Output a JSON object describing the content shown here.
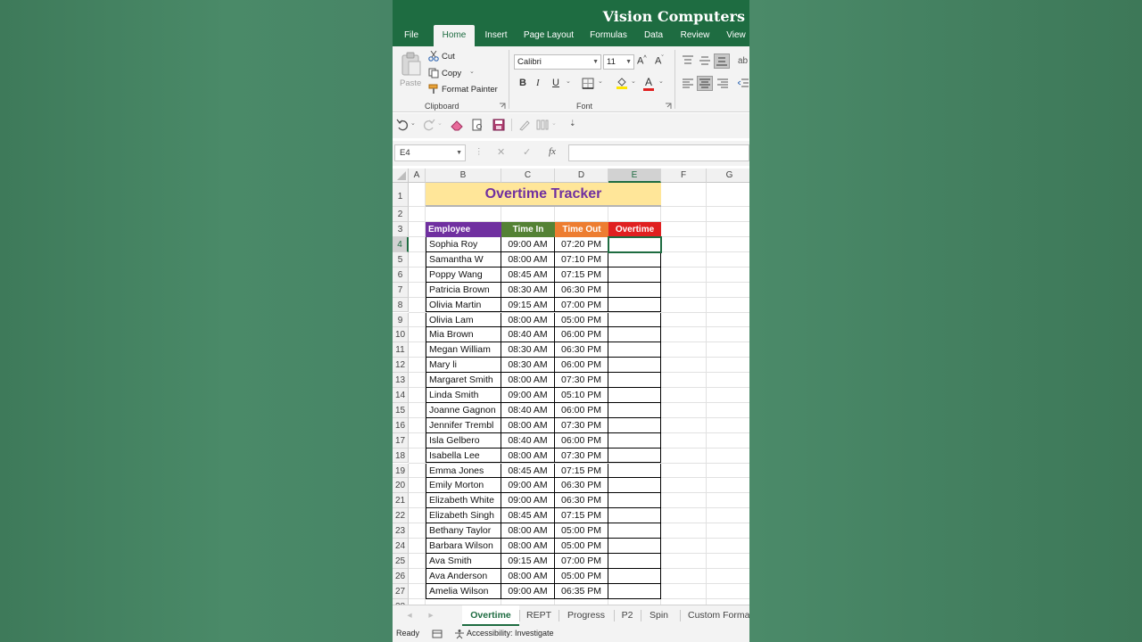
{
  "brand": "Vision Computers",
  "ribbon_tabs": [
    "File",
    "Home",
    "Insert",
    "Page Layout",
    "Formulas",
    "Data",
    "Review",
    "View"
  ],
  "active_tab": "Home",
  "clipboard": {
    "paste": "Paste",
    "cut": "Cut",
    "copy": "Copy",
    "format_painter": "Format Painter",
    "group_label": "Clipboard"
  },
  "font": {
    "name": "Calibri",
    "size": "11",
    "bold": "B",
    "italic": "I",
    "underline": "U",
    "group_label": "Font",
    "grow": "A^",
    "shrink": "Aˇ"
  },
  "formula_bar": {
    "name_box": "E4",
    "fx": "fx",
    "value": ""
  },
  "columns": [
    "A",
    "B",
    "C",
    "D",
    "E",
    "F",
    "G"
  ],
  "selected_column": "E",
  "selected_row": 4,
  "sheet": {
    "title": "Overtime Tracker",
    "headers": [
      "Employee",
      "Time In",
      "Time Out",
      "Overtime"
    ],
    "header_colors": [
      "#7030a0",
      "#548235",
      "#ed7d31",
      "#e02020"
    ],
    "rows": [
      [
        "Sophia Roy",
        "09:00 AM",
        "07:20 PM",
        ""
      ],
      [
        "Samantha W",
        "08:00 AM",
        "07:10 PM",
        ""
      ],
      [
        "Poppy Wang",
        "08:45 AM",
        "07:15 PM",
        ""
      ],
      [
        "Patricia Brown",
        "08:30 AM",
        "06:30 PM",
        ""
      ],
      [
        "Olivia Martin",
        "09:15 AM",
        "07:00 PM",
        ""
      ],
      [
        "Olivia Lam",
        "08:00 AM",
        "05:00 PM",
        ""
      ],
      [
        "Mia Brown",
        "08:40 AM",
        "06:00 PM",
        ""
      ],
      [
        "Megan William",
        "08:30 AM",
        "06:30 PM",
        ""
      ],
      [
        "Mary li",
        "08:30 AM",
        "06:00 PM",
        ""
      ],
      [
        "Margaret Smith",
        "08:00 AM",
        "07:30 PM",
        ""
      ],
      [
        "Linda Smith",
        "09:00 AM",
        "05:10 PM",
        ""
      ],
      [
        "Joanne Gagnon",
        "08:40 AM",
        "06:00 PM",
        ""
      ],
      [
        "Jennifer Trembl",
        "08:00 AM",
        "07:30 PM",
        ""
      ],
      [
        "Isla Gelbero",
        "08:40 AM",
        "06:00 PM",
        ""
      ],
      [
        "Isabella Lee",
        "08:00 AM",
        "07:30 PM",
        ""
      ],
      [
        "Emma Jones",
        "08:45 AM",
        "07:15 PM",
        ""
      ],
      [
        "Emily Morton",
        "09:00 AM",
        "06:30 PM",
        ""
      ],
      [
        "Elizabeth White",
        "09:00 AM",
        "06:30 PM",
        ""
      ],
      [
        "Elizabeth Singh",
        "08:45 AM",
        "07:15 PM",
        ""
      ],
      [
        "Bethany Taylor",
        "08:00 AM",
        "05:00 PM",
        ""
      ],
      [
        "Barbara Wilson",
        "08:00 AM",
        "05:00 PM",
        ""
      ],
      [
        "Ava Smith",
        "09:15 AM",
        "07:00 PM",
        ""
      ],
      [
        "Ava Anderson",
        "08:00 AM",
        "05:00 PM",
        ""
      ],
      [
        "Amelia Wilson",
        "09:00 AM",
        "06:35 PM",
        ""
      ]
    ]
  },
  "sheet_tabs": [
    "Overtime",
    "REPT",
    "Progress",
    "P2",
    "Spin",
    "Custom Format"
  ],
  "active_sheet": "Overtime",
  "status": {
    "ready": "Ready",
    "accessibility": "Accessibility: Investigate"
  },
  "colors": {
    "excel_green": "#1e6c41",
    "title_fill": "#ffe699",
    "title_text": "#7030a0",
    "background": "#468563"
  }
}
